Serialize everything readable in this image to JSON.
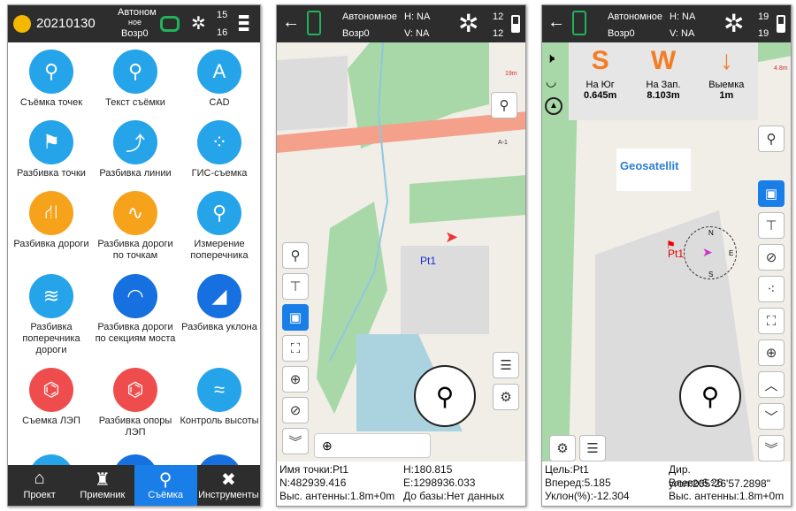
{
  "panel1": {
    "header": {
      "title": "20210130",
      "mode_line1": "Автоном",
      "mode_line2": "ное",
      "age": "Возр0",
      "sats_top": "15",
      "sats_bottom": "16"
    },
    "items": [
      {
        "label": "Съёмка точек",
        "color": "#26a4ea",
        "icon": "point-survey-icon"
      },
      {
        "label": "Текст съёмки",
        "color": "#26a4ea",
        "icon": "text-survey-icon"
      },
      {
        "label": "CAD",
        "color": "#26a4ea",
        "icon": "cad-icon"
      },
      {
        "label": "Разбивка точки",
        "color": "#26a4ea",
        "icon": "point-stakeout-icon"
      },
      {
        "label": "Разбивка линии",
        "color": "#26a4ea",
        "icon": "line-stakeout-icon"
      },
      {
        "label": "ГИС-съемка",
        "color": "#26a4ea",
        "icon": "gis-survey-icon"
      },
      {
        "label": "Разбивка дороги",
        "color": "#f7a21b",
        "icon": "road-stakeout-icon"
      },
      {
        "label": "Разбивка дороги по точкам",
        "color": "#f7a21b",
        "icon": "road-points-icon"
      },
      {
        "label": "Измерение поперечника",
        "color": "#26a4ea",
        "icon": "cross-section-icon"
      },
      {
        "label": "Разбивка поперечника дороги",
        "color": "#26a4ea",
        "icon": "road-cross-section-icon"
      },
      {
        "label": "Разбивка дороги по секциям моста",
        "color": "#1670e0",
        "icon": "bridge-section-icon"
      },
      {
        "label": "Разбивка уклона",
        "color": "#1670e0",
        "icon": "slope-stakeout-icon"
      },
      {
        "label": "Съемка ЛЭП",
        "color": "#ef4d4d",
        "icon": "power-line-icon"
      },
      {
        "label": "Разбивка опоры ЛЭП",
        "color": "#ef4d4d",
        "icon": "power-tower-icon"
      },
      {
        "label": "Контроль высоты",
        "color": "#26a4ea",
        "icon": "height-control-icon"
      }
    ],
    "nav": [
      {
        "label": "Проект",
        "icon": "home-icon"
      },
      {
        "label": "Приемник",
        "icon": "receiver-icon"
      },
      {
        "label": "Съёмка",
        "icon": "survey-pin-icon",
        "active": true
      },
      {
        "label": "Инструменты",
        "icon": "tools-icon"
      }
    ]
  },
  "panel2": {
    "header": {
      "mode": "Автономное",
      "age": "Возр0",
      "h": "H: NA",
      "v": "V: NA",
      "sats_top": "12",
      "sats_bottom": "12"
    },
    "map": {
      "point": "Pt1",
      "scale": "19m",
      "road": "А-1"
    },
    "info": {
      "name": "Имя точки:Pt1",
      "h": "H:180.815",
      "n": "N:482939.416",
      "e": "E:1298936.033",
      "antenna": "Выс. антенны:1.8m+0m",
      "base": "До базы:Нет данных"
    }
  },
  "panel3": {
    "header": {
      "mode": "Автономное",
      "age": "Возр0",
      "h": "H: NA",
      "v": "V: NA",
      "sats_top": "19",
      "sats_bottom": "19"
    },
    "nav_box": [
      {
        "letter": "S",
        "label": "На Юг",
        "value": "0.645m"
      },
      {
        "letter": "W",
        "label": "На Зап.",
        "value": "8.103m"
      },
      {
        "letter": "↓",
        "label": "Выемка",
        "value": "1m"
      }
    ],
    "map": {
      "point": "Pt1",
      "scale": "4.8m",
      "logo": "Geosatellit",
      "compass": {
        "n": "N",
        "s": "S",
        "e": "E"
      }
    },
    "info": {
      "target": "Цель:Pt1",
      "azimuth": "Дир. угол:265°26'57.2898\"",
      "forward": "Вперед:5.185",
      "left": "Влево:6.26",
      "slope": "Уклон(%):-12.304",
      "antenna": "Выс. антенны:1.8m+0m"
    }
  }
}
